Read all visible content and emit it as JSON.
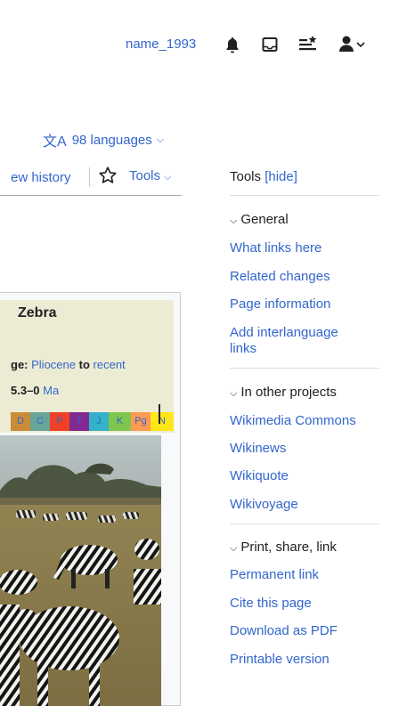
{
  "header": {
    "username": "name_1993",
    "icons": [
      "bell-icon",
      "inbox-icon",
      "watchlist-icon",
      "user-menu-icon"
    ]
  },
  "languages": {
    "label": "98 languages"
  },
  "tabs": {
    "view_history": "ew history",
    "tools": "Tools"
  },
  "infobox": {
    "title": "Zebra",
    "range_prefix": "ge:",
    "range_start": "Pliocene",
    "range_mid": "to",
    "range_end": "recent",
    "ma_value": "5.3–0",
    "ma_unit": "Ma",
    "timescale": [
      "D",
      "C",
      "P",
      "T",
      "J",
      "K",
      "Pg",
      "N"
    ],
    "timescale_colors": [
      "#cb8c37",
      "#67a599",
      "#f04028",
      "#812b92",
      "#34b2c9",
      "#7fc64e",
      "#fd9a52",
      "#ffe619"
    ]
  },
  "tools_panel": {
    "title": "Tools",
    "hide_label": "[hide]",
    "sections": [
      {
        "heading": "General",
        "items": [
          "What links here",
          "Related changes",
          "Page information",
          "Add interlanguage links"
        ]
      },
      {
        "heading": "In other projects",
        "items": [
          "Wikimedia Commons",
          "Wikinews",
          "Wikiquote",
          "Wikivoyage"
        ]
      },
      {
        "heading": "Print, share, link",
        "items": [
          "Permanent link",
          "Cite this page",
          "Download as PDF",
          "Printable version"
        ]
      }
    ]
  },
  "colors": {
    "link": "#3366cc",
    "text": "#202122",
    "infobox_header": "#ececd4"
  }
}
